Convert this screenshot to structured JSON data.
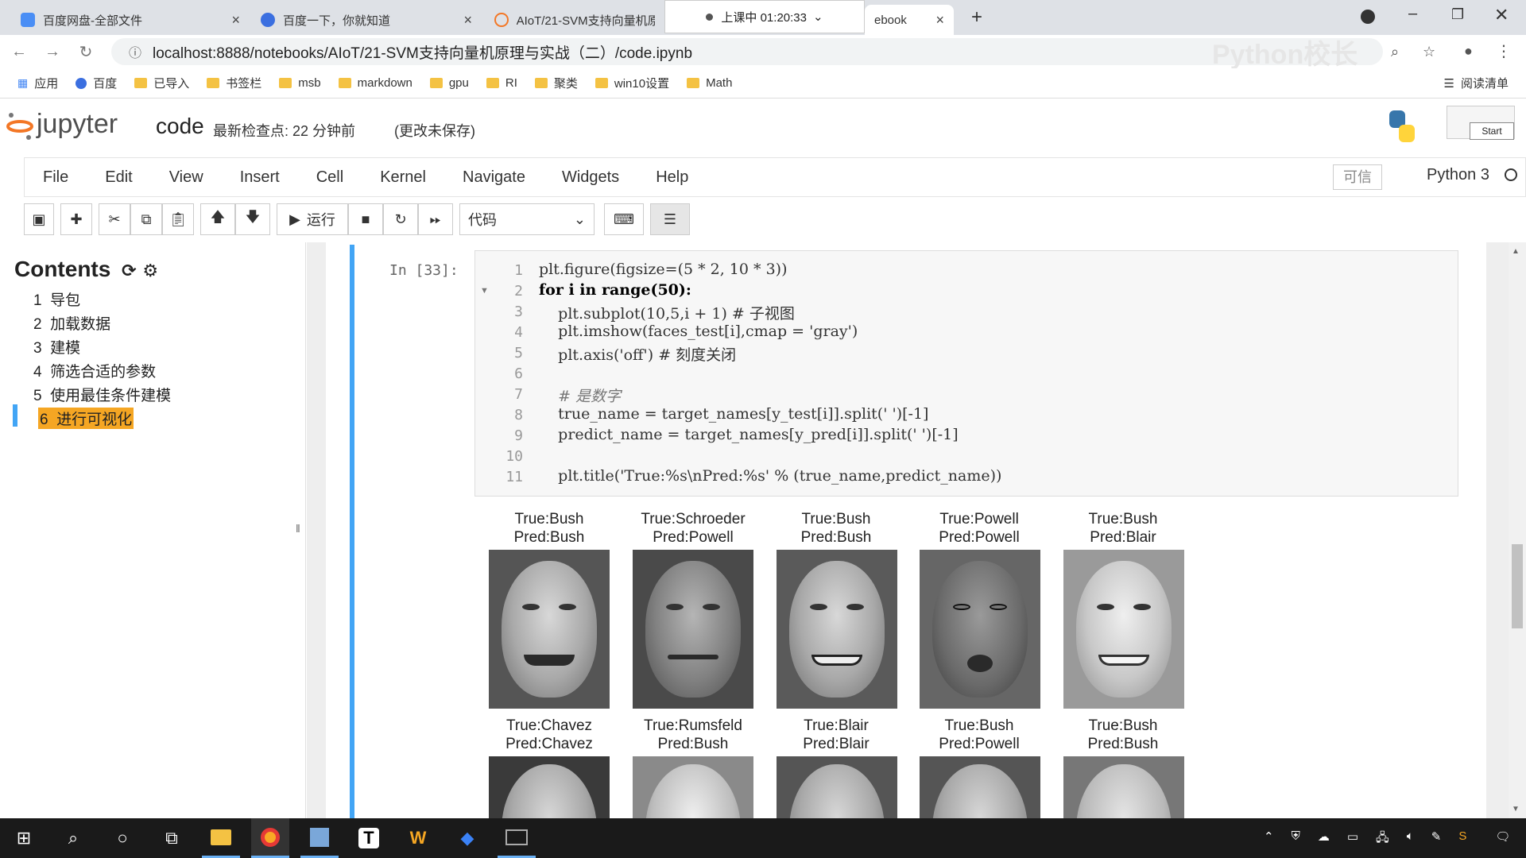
{
  "browser": {
    "tabs": [
      {
        "label": "百度网盘-全部文件"
      },
      {
        "label": "百度一下，你就知道"
      },
      {
        "label": "AIoT/21-SVM支持向量机原"
      },
      {
        "label": "ebook"
      }
    ],
    "recording": "上课中 01:20:33",
    "url": "localhost:8888/notebooks/AIoT/21-SVM支持向量机原理与实战（二）/code.ipynb",
    "watermark": "Python校长",
    "reading_list": "阅读清单",
    "bookmarks": [
      "应用",
      "百度",
      "已导入",
      "书签栏",
      "msb",
      "markdown",
      "gpu",
      "RI",
      "聚类",
      "win10设置",
      "Math"
    ]
  },
  "jupyter": {
    "logo": "jupyter",
    "notebook_name": "code",
    "checkpoint": "最新检查点: 22 分钟前",
    "unsaved": "(更改未保存)",
    "start_label": "Start",
    "menu": [
      "File",
      "Edit",
      "View",
      "Insert",
      "Cell",
      "Kernel",
      "Navigate",
      "Widgets",
      "Help"
    ],
    "trusted": "可信",
    "kernel": "Python 3",
    "run_label": "运行",
    "cell_type": "代码"
  },
  "toc": {
    "title": "Contents",
    "items": [
      {
        "num": "1",
        "label": "导包"
      },
      {
        "num": "2",
        "label": "加载数据"
      },
      {
        "num": "3",
        "label": "建模"
      },
      {
        "num": "4",
        "label": "筛选合适的参数"
      },
      {
        "num": "5",
        "label": "使用最佳条件建模"
      },
      {
        "num": "6",
        "label": "进行可视化"
      }
    ]
  },
  "cell": {
    "prompt": "In  [33]:",
    "lines": [
      "plt.figure(figsize=(5 * 2, 10 * 3))",
      "for i in range(50):",
      "    plt.subplot(10,5,i + 1) # 子视图",
      "    plt.imshow(faces_test[i],cmap = 'gray')",
      "    plt.axis('off') # 刻度关闭",
      "",
      "    # 是数字",
      "    true_name = target_names[y_test[i]].split(' ')[-1]",
      "    predict_name = target_names[y_pred[i]].split(' ')[-1]",
      "",
      "    plt.title('True:%s\\nPred:%s' % (true_name,predict_name))"
    ]
  },
  "output": {
    "row1": [
      {
        "true": "True:Bush",
        "pred": "Pred:Bush"
      },
      {
        "true": "True:Schroeder",
        "pred": "Pred:Powell"
      },
      {
        "true": "True:Bush",
        "pred": "Pred:Bush"
      },
      {
        "true": "True:Powell",
        "pred": "Pred:Powell"
      },
      {
        "true": "True:Bush",
        "pred": "Pred:Blair"
      }
    ],
    "row2": [
      {
        "true": "True:Chavez",
        "pred": "Pred:Chavez"
      },
      {
        "true": "True:Rumsfeld",
        "pred": "Pred:Bush"
      },
      {
        "true": "True:Blair",
        "pred": "Pred:Blair"
      },
      {
        "true": "True:Bush",
        "pred": "Pred:Powell"
      },
      {
        "true": "True:Bush",
        "pred": "Pred:Bush"
      }
    ]
  }
}
